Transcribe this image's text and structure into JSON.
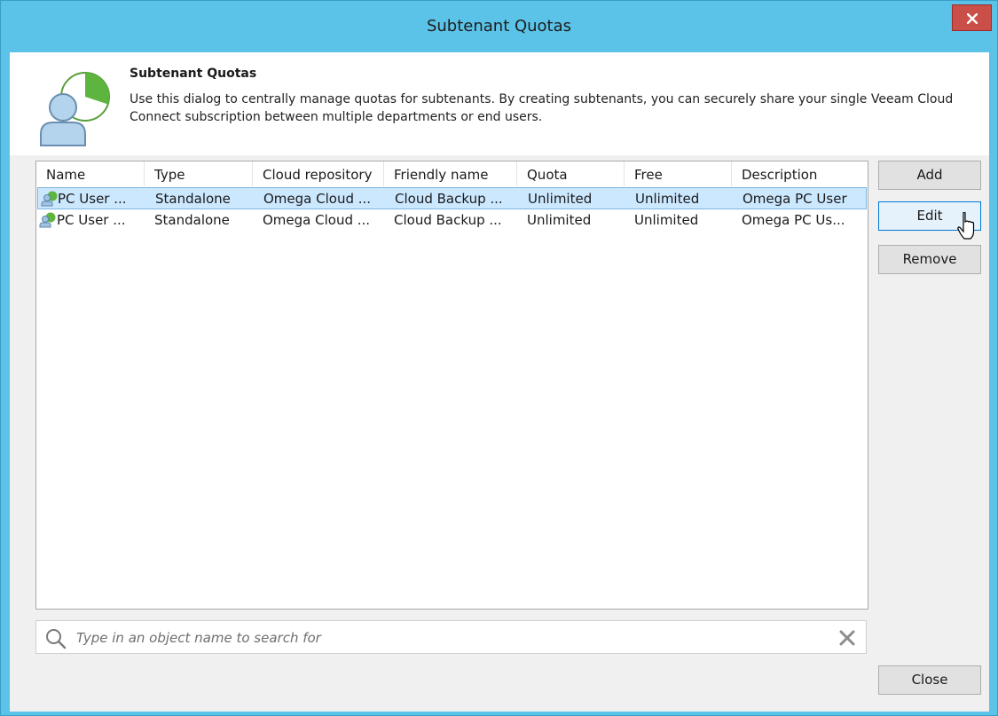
{
  "window": {
    "title": "Subtenant Quotas",
    "accent_color": "#5bc3e8",
    "close_icon": "close-icon"
  },
  "header": {
    "title": "Subtenant Quotas",
    "description": "Use this dialog to centrally manage quotas for subtenants. By creating subtenants, you can securely share your single Veeam Cloud Connect subscription between multiple departments or end users.",
    "icon": "subtenant-quota-icon"
  },
  "table": {
    "columns": [
      "Name",
      "Type",
      "Cloud repository",
      "Friendly name",
      "Quota",
      "Free",
      "Description"
    ],
    "rows": [
      {
        "name": "PC User ...",
        "type": "Standalone",
        "repository": "Omega Cloud ...",
        "friendly": "Cloud Backup ...",
        "quota": "Unlimited",
        "free": "Unlimited",
        "description": "Omega PC User",
        "selected": true
      },
      {
        "name": "PC User ...",
        "type": "Standalone",
        "repository": "Omega Cloud ...",
        "friendly": "Cloud Backup ...",
        "quota": "Unlimited",
        "free": "Unlimited",
        "description": "Omega PC Us...",
        "selected": false
      }
    ],
    "row_icon": "subtenant-icon"
  },
  "buttons": {
    "add": "Add",
    "edit": "Edit",
    "remove": "Remove",
    "close": "Close"
  },
  "search": {
    "placeholder": "Type in an object name to search for",
    "value": "",
    "icon": "search-icon",
    "clear_icon": "clear-icon"
  }
}
